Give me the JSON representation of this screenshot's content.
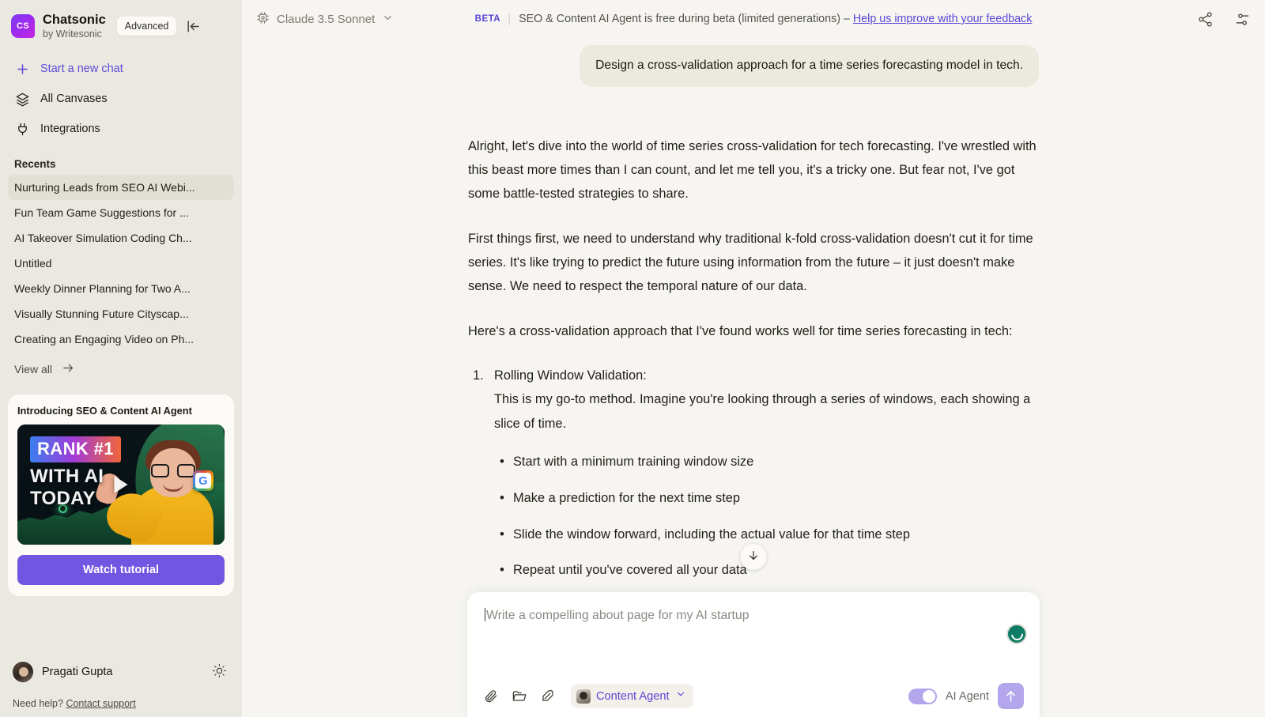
{
  "sidebar": {
    "brand": {
      "name": "Chatsonic",
      "subtitle": "by Writesonic",
      "logo_text": "CS"
    },
    "advanced_label": "Advanced",
    "nav": [
      {
        "label": "Start a new chat",
        "icon": "plus-icon"
      },
      {
        "label": "All Canvases",
        "icon": "layers-icon"
      },
      {
        "label": "Integrations",
        "icon": "plug-icon"
      }
    ],
    "recents_title": "Recents",
    "recents": [
      "Nurturing Leads from SEO AI Webi...",
      "Fun Team Game Suggestions for ...",
      "AI Takeover Simulation Coding Ch...",
      "Untitled",
      "Weekly Dinner Planning for Two A...",
      "Visually Stunning Future Cityscap...",
      "Creating an Engaging Video on Ph..."
    ],
    "view_all_label": "View all",
    "promo": {
      "title": "Introducing SEO & Content AI Agent",
      "thumb_line1": "RANK #1",
      "thumb_line2": "WITH AI",
      "thumb_line3": "TODAY",
      "thumb_badge": "G",
      "button_label": "Watch tutorial"
    },
    "user": {
      "name": "Pragati Gupta"
    },
    "help_prefix": "Need help?",
    "help_link": "Contact support"
  },
  "topbar": {
    "model": "Claude 3.5 Sonnet",
    "beta_tag": "BETA",
    "beta_text": "SEO & Content AI Agent is free during beta (limited generations) – ",
    "beta_link": "Help us improve with your feedback"
  },
  "chat": {
    "user_message": "Design a cross-validation approach for a time series forecasting model in tech.",
    "assistant_paragraphs": [
      "Alright, let's dive into the world of time series cross-validation for tech forecasting. I've wrestled with this beast more times than I can count, and let me tell you, it's a tricky one. But fear not, I've got some battle-tested strategies to share.",
      "First things first, we need to understand why traditional k-fold cross-validation doesn't cut it for time series. It's like trying to predict the future using information from the future – it just doesn't make sense. We need to respect the temporal nature of our data.",
      "Here's a cross-validation approach that I've found works well for time series forecasting in tech:"
    ],
    "list_number": "1.",
    "item_heading": "Rolling Window Validation:",
    "item_desc": "This is my go-to method. Imagine you're looking through a series of windows, each showing a slice of time.",
    "bullets": [
      "Start with a minimum training window size",
      "Make a prediction for the next time step",
      "Slide the window forward, including the actual value for that time step",
      "Repeat until you've covered all your data"
    ]
  },
  "composer": {
    "placeholder": "Write a compelling about page for my AI startup",
    "agent_label": "Content Agent",
    "toggle_label": "AI Agent"
  },
  "colors": {
    "accent": "#5b45d6",
    "sidebar_bg": "#eae9e1",
    "main_bg": "#f6f5f1",
    "send_button": "#b3a6ec",
    "watch_button": "#7056e0"
  }
}
